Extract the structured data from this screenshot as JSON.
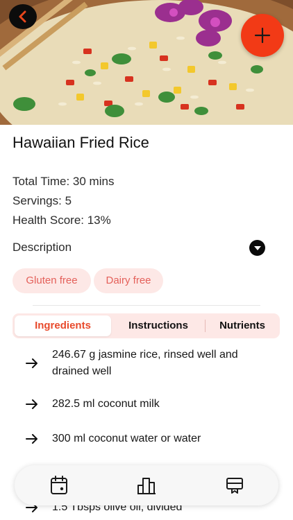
{
  "recipe": {
    "title": "Hawaiian Fried Rice",
    "total_time": "Total Time: 30 mins",
    "servings": "Servings: 5",
    "health_score": "Health Score: 13%",
    "description_label": "Description",
    "tags": [
      "Gluten free",
      "Dairy free"
    ]
  },
  "tabs": [
    {
      "label": "Ingredients",
      "active": true
    },
    {
      "label": "Instructions",
      "active": false
    },
    {
      "label": "Nutrients",
      "active": false
    }
  ],
  "ingredients": [
    "246.67 g jasmine rice, rinsed well and drained well",
    "282.5 ml coconut milk",
    "300 ml coconut water or water",
    "1.5 Tbsps olive oil, divided"
  ],
  "icons": {
    "back": "chevron-left-icon",
    "fab": "plus-icon",
    "description_toggle": "chevron-down-icon",
    "ingredient_bullet": "arrow-right-icon",
    "nav": [
      "calendar-icon",
      "bar-chart-icon",
      "meal-plan-icon"
    ]
  },
  "colors": {
    "accent": "#f23a16",
    "tag_background": "#fde8e6",
    "tag_text": "#e4605a",
    "active_tab_text": "#e84a2c"
  }
}
